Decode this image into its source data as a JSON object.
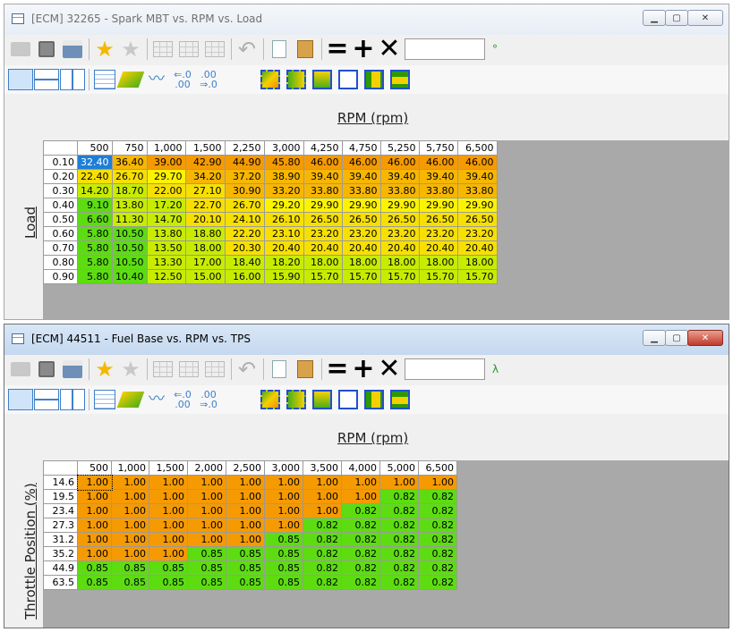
{
  "colors": {
    "orange": "#f59a00",
    "lightorange": "#f7b600",
    "yellow": "#f7e000",
    "lightyellow": "#fbf300",
    "yellowgreen": "#c8ec00",
    "green": "#5ddc12",
    "selected": "#1e7fd8"
  },
  "toolbar": {
    "icons": [
      "open-folder-icon",
      "save-icon",
      "print-icon",
      "add-favorite-icon",
      "remove-favorite-icon",
      "table-icon",
      "table-insert-icon",
      "table-delete-icon",
      "undo-icon",
      "copy-icon",
      "paste-icon",
      "equals-icon",
      "plus-icon",
      "multiply-icon"
    ]
  },
  "windows": [
    {
      "title": "[ECM] 32265 - Spark MBT vs. RPM vs. Load",
      "unit_symbol": "°",
      "x_axis_label": "RPM (rpm)",
      "y_axis_label": "Load",
      "columns": [
        "500",
        "750",
        "1,000",
        "1,500",
        "2,250",
        "3,000",
        "4,250",
        "4,750",
        "5,250",
        "5,750",
        "6,500"
      ],
      "rows": [
        {
          "label": "0.10",
          "cells": [
            "32.40",
            "36.40",
            "39.00",
            "42.90",
            "44.90",
            "45.80",
            "46.00",
            "46.00",
            "46.00",
            "46.00",
            "46.00"
          ],
          "colors": [
            "selected",
            "lightorange",
            "orange",
            "orange",
            "orange",
            "orange",
            "orange",
            "orange",
            "orange",
            "orange",
            "orange"
          ]
        },
        {
          "label": "0.20",
          "cells": [
            "22.40",
            "26.70",
            "29.70",
            "34.20",
            "37.20",
            "38.90",
            "39.40",
            "39.40",
            "39.40",
            "39.40",
            "39.40"
          ],
          "colors": [
            "yellow",
            "yellow",
            "lightyellow",
            "lightorange",
            "lightorange",
            "lightorange",
            "lightorange",
            "lightorange",
            "lightorange",
            "lightorange",
            "lightorange"
          ]
        },
        {
          "label": "0.30",
          "cells": [
            "14.20",
            "18.70",
            "22.00",
            "27.10",
            "30.90",
            "33.20",
            "33.80",
            "33.80",
            "33.80",
            "33.80",
            "33.80"
          ],
          "colors": [
            "yellowgreen",
            "yellowgreen",
            "yellow",
            "yellow",
            "lightorange",
            "lightorange",
            "lightorange",
            "lightorange",
            "lightorange",
            "lightorange",
            "lightorange"
          ]
        },
        {
          "label": "0.40",
          "cells": [
            "9.10",
            "13.80",
            "17.20",
            "22.70",
            "26.70",
            "29.20",
            "29.90",
            "29.90",
            "29.90",
            "29.90",
            "29.90"
          ],
          "colors": [
            "green",
            "yellowgreen",
            "yellowgreen",
            "yellow",
            "yellow",
            "lightyellow",
            "lightyellow",
            "lightyellow",
            "lightyellow",
            "lightyellow",
            "lightyellow"
          ]
        },
        {
          "label": "0.50",
          "cells": [
            "6.60",
            "11.30",
            "14.70",
            "20.10",
            "24.10",
            "26.10",
            "26.50",
            "26.50",
            "26.50",
            "26.50",
            "26.50"
          ],
          "colors": [
            "green",
            "yellowgreen",
            "yellowgreen",
            "yellow",
            "yellow",
            "yellow",
            "yellow",
            "yellow",
            "yellow",
            "yellow",
            "yellow"
          ]
        },
        {
          "label": "0.60",
          "cells": [
            "5.80",
            "10.50",
            "13.80",
            "18.80",
            "22.20",
            "23.10",
            "23.20",
            "23.20",
            "23.20",
            "23.20",
            "23.20"
          ],
          "colors": [
            "green",
            "green",
            "yellowgreen",
            "yellowgreen",
            "yellow",
            "yellow",
            "yellow",
            "yellow",
            "yellow",
            "yellow",
            "yellow"
          ]
        },
        {
          "label": "0.70",
          "cells": [
            "5.80",
            "10.50",
            "13.50",
            "18.00",
            "20.30",
            "20.40",
            "20.40",
            "20.40",
            "20.40",
            "20.40",
            "20.40"
          ],
          "colors": [
            "green",
            "green",
            "yellowgreen",
            "yellowgreen",
            "yellow",
            "yellow",
            "yellow",
            "yellow",
            "yellow",
            "yellow",
            "yellow"
          ]
        },
        {
          "label": "0.80",
          "cells": [
            "5.80",
            "10.50",
            "13.30",
            "17.00",
            "18.40",
            "18.20",
            "18.00",
            "18.00",
            "18.00",
            "18.00",
            "18.00"
          ],
          "colors": [
            "green",
            "green",
            "yellowgreen",
            "yellowgreen",
            "yellowgreen",
            "yellowgreen",
            "yellowgreen",
            "yellowgreen",
            "yellowgreen",
            "yellowgreen",
            "yellowgreen"
          ]
        },
        {
          "label": "0.90",
          "cells": [
            "5.80",
            "10.40",
            "12.50",
            "15.00",
            "16.00",
            "15.90",
            "15.70",
            "15.70",
            "15.70",
            "15.70",
            "15.70"
          ],
          "colors": [
            "green",
            "green",
            "yellowgreen",
            "yellowgreen",
            "yellowgreen",
            "yellowgreen",
            "yellowgreen",
            "yellowgreen",
            "yellowgreen",
            "yellowgreen",
            "yellowgreen"
          ]
        }
      ]
    },
    {
      "title": "[ECM] 44511 - Fuel Base vs. RPM vs. TPS",
      "unit_symbol": "λ",
      "x_axis_label": "RPM (rpm)",
      "y_axis_label": "Throttle Position (%)",
      "columns": [
        "500",
        "1,000",
        "1,500",
        "2,000",
        "2,500",
        "3,000",
        "3,500",
        "4,000",
        "5,000",
        "6,500"
      ],
      "rows": [
        {
          "label": "14.6",
          "cells": [
            "1.00",
            "1.00",
            "1.00",
            "1.00",
            "1.00",
            "1.00",
            "1.00",
            "1.00",
            "1.00",
            "1.00"
          ],
          "colors": [
            "orange",
            "orange",
            "orange",
            "orange",
            "orange",
            "orange",
            "orange",
            "orange",
            "orange",
            "orange"
          ]
        },
        {
          "label": "19.5",
          "cells": [
            "1.00",
            "1.00",
            "1.00",
            "1.00",
            "1.00",
            "1.00",
            "1.00",
            "1.00",
            "0.82",
            "0.82"
          ],
          "colors": [
            "orange",
            "orange",
            "orange",
            "orange",
            "orange",
            "orange",
            "orange",
            "orange",
            "green",
            "green"
          ]
        },
        {
          "label": "23.4",
          "cells": [
            "1.00",
            "1.00",
            "1.00",
            "1.00",
            "1.00",
            "1.00",
            "1.00",
            "0.82",
            "0.82",
            "0.82"
          ],
          "colors": [
            "orange",
            "orange",
            "orange",
            "orange",
            "orange",
            "orange",
            "orange",
            "green",
            "green",
            "green"
          ]
        },
        {
          "label": "27.3",
          "cells": [
            "1.00",
            "1.00",
            "1.00",
            "1.00",
            "1.00",
            "1.00",
            "0.82",
            "0.82",
            "0.82",
            "0.82"
          ],
          "colors": [
            "orange",
            "orange",
            "orange",
            "orange",
            "orange",
            "orange",
            "green",
            "green",
            "green",
            "green"
          ]
        },
        {
          "label": "31.2",
          "cells": [
            "1.00",
            "1.00",
            "1.00",
            "1.00",
            "1.00",
            "0.85",
            "0.82",
            "0.82",
            "0.82",
            "0.82"
          ],
          "colors": [
            "orange",
            "orange",
            "orange",
            "orange",
            "orange",
            "green",
            "green",
            "green",
            "green",
            "green"
          ]
        },
        {
          "label": "35.2",
          "cells": [
            "1.00",
            "1.00",
            "1.00",
            "0.85",
            "0.85",
            "0.85",
            "0.82",
            "0.82",
            "0.82",
            "0.82"
          ],
          "colors": [
            "orange",
            "orange",
            "orange",
            "green",
            "green",
            "green",
            "green",
            "green",
            "green",
            "green"
          ]
        },
        {
          "label": "44.9",
          "cells": [
            "0.85",
            "0.85",
            "0.85",
            "0.85",
            "0.85",
            "0.85",
            "0.82",
            "0.82",
            "0.82",
            "0.82"
          ],
          "colors": [
            "green",
            "green",
            "green",
            "green",
            "green",
            "green",
            "green",
            "green",
            "green",
            "green"
          ]
        },
        {
          "label": "63.5",
          "cells": [
            "0.85",
            "0.85",
            "0.85",
            "0.85",
            "0.85",
            "0.85",
            "0.82",
            "0.82",
            "0.82",
            "0.82"
          ],
          "colors": [
            "green",
            "green",
            "green",
            "green",
            "green",
            "green",
            "green",
            "green",
            "green",
            "green"
          ]
        }
      ]
    }
  ]
}
